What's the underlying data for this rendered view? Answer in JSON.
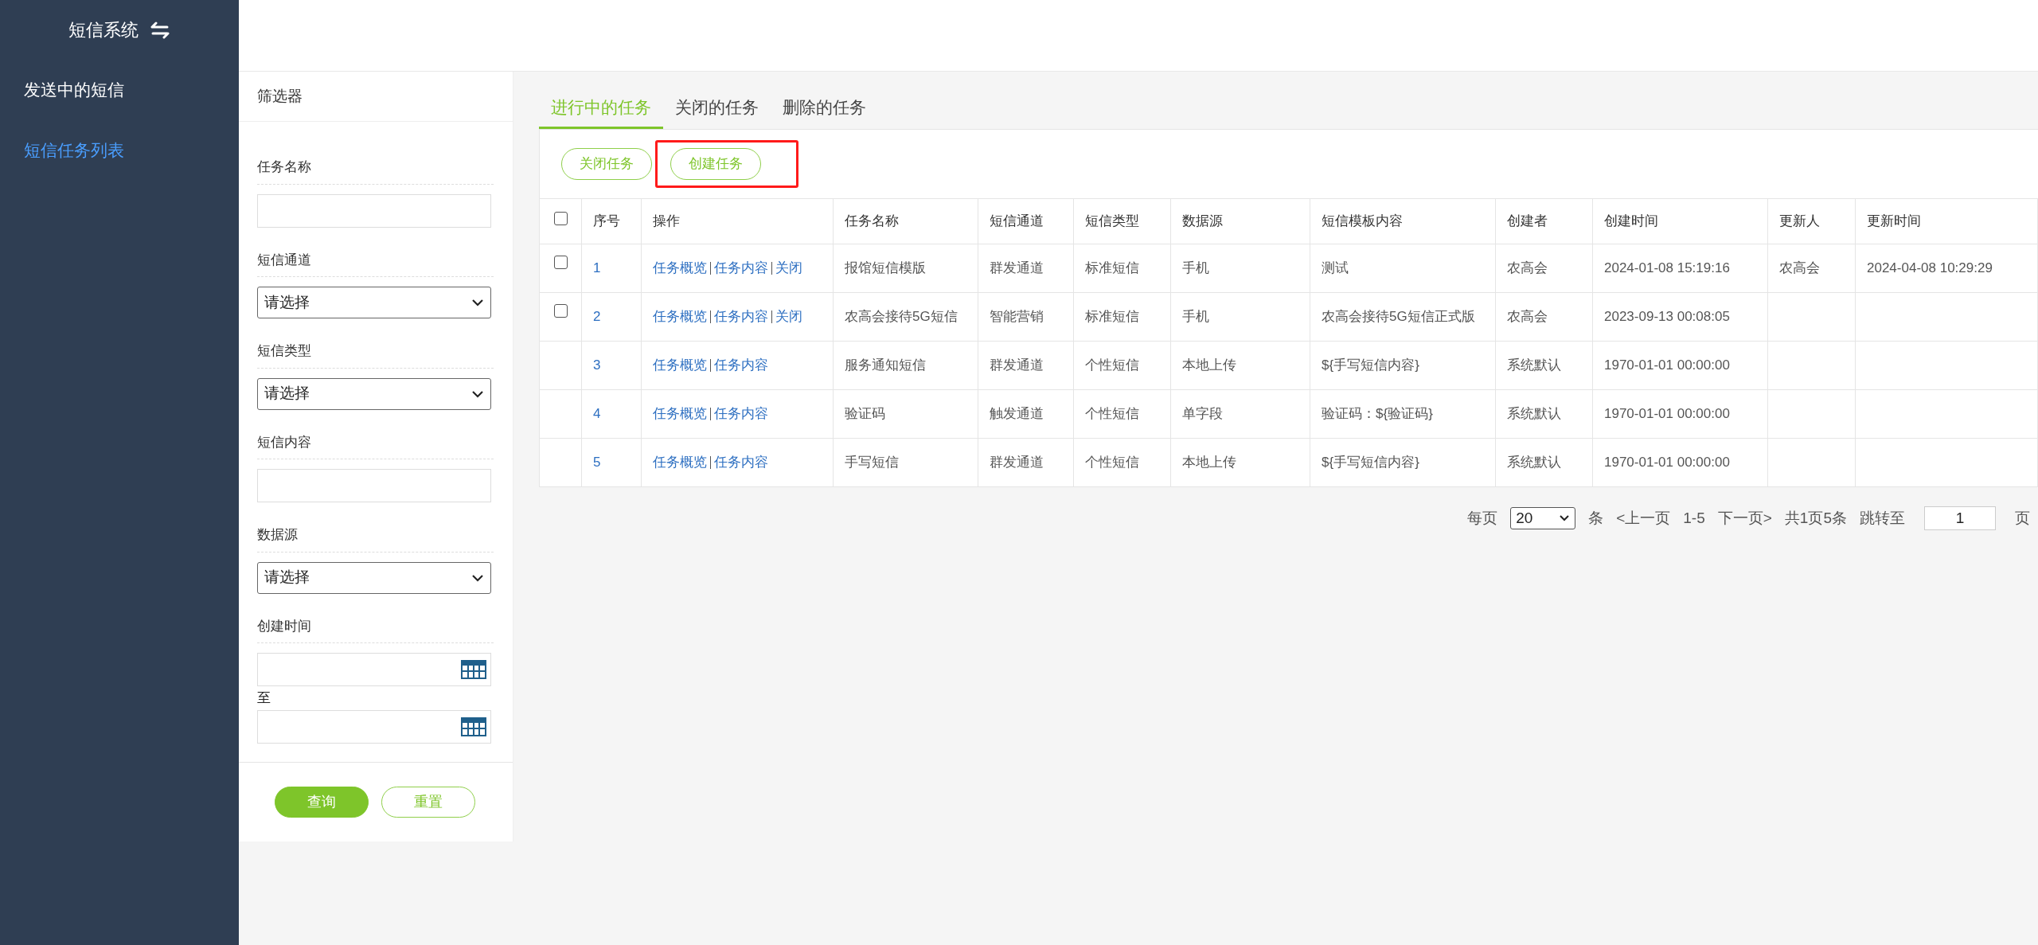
{
  "sidebar": {
    "title": "短信系统",
    "items": [
      {
        "label": "发送中的短信",
        "selected": false
      },
      {
        "label": "短信任务列表",
        "selected": true
      }
    ]
  },
  "filter": {
    "title": "筛选器",
    "fields": [
      {
        "kind": "text",
        "label": "任务名称"
      },
      {
        "kind": "select",
        "label": "短信通道",
        "value": "请选择"
      },
      {
        "kind": "select",
        "label": "短信类型",
        "value": "请选择"
      },
      {
        "kind": "text",
        "label": "短信内容"
      },
      {
        "kind": "select",
        "label": "数据源",
        "value": "请选择"
      },
      {
        "kind": "daterange",
        "label": "创建时间",
        "separator": "至"
      }
    ],
    "buttons": [
      {
        "label": "查询",
        "primary": true
      },
      {
        "label": "重置",
        "primary": false
      }
    ]
  },
  "tabs": [
    {
      "label": "进行中的任务",
      "selected": true
    },
    {
      "label": "关闭的任务",
      "selected": false
    },
    {
      "label": "删除的任务",
      "selected": false
    }
  ],
  "toolbar": [
    {
      "label": "关闭任务",
      "highlighted": false
    },
    {
      "label": "创建任务",
      "highlighted": true
    }
  ],
  "table": {
    "columns": [
      "序号",
      "操作",
      "任务名称",
      "短信通道",
      "短信类型",
      "数据源",
      "短信模板内容",
      "创建者",
      "创建时间",
      "更新人",
      "更新时间"
    ],
    "header_checked": false,
    "rows": [
      {
        "checked": false,
        "cells": [
          "1",
          [
            "任务概览",
            "任务内容",
            "关闭"
          ],
          "报馆短信模版",
          "群发通道",
          "标准短信",
          "手机",
          "测试",
          "农高会",
          "2024-01-08 15:19:16",
          "农高会",
          "2024-04-08 10:29:29"
        ]
      },
      {
        "checked": false,
        "cells": [
          "2",
          [
            "任务概览",
            "任务内容",
            "关闭"
          ],
          "农高会接待5G短信",
          "智能营销",
          "标准短信",
          "手机",
          "农高会接待5G短信正式版",
          "农高会",
          "2023-09-13 00:08:05",
          "",
          ""
        ]
      },
      {
        "cells": [
          "3",
          [
            "任务概览",
            "任务内容"
          ],
          "服务通知短信",
          "群发通道",
          "个性短信",
          "本地上传",
          "${手写短信内容}",
          "系统默认",
          "1970-01-01 00:00:00",
          "",
          ""
        ]
      },
      {
        "cells": [
          "4",
          [
            "任务概览",
            "任务内容"
          ],
          "验证码",
          "触发通道",
          "个性短信",
          "单字段",
          "验证码：${验证码}",
          "系统默认",
          "1970-01-01 00:00:00",
          "",
          ""
        ]
      },
      {
        "cells": [
          "5",
          [
            "任务概览",
            "任务内容"
          ],
          "手写短信",
          "群发通道",
          "个性短信",
          "本地上传",
          "${手写短信内容}",
          "系统默认",
          "1970-01-01 00:00:00",
          "",
          ""
        ]
      }
    ]
  },
  "pagination": {
    "per_page_label": "每页",
    "per_page": "20",
    "unit": "条",
    "prev": "<上一页",
    "range": "1-5",
    "next": "下一页>",
    "total": "共1页5条",
    "jump_label": "跳转至",
    "page": "1",
    "page_unit": "页"
  }
}
